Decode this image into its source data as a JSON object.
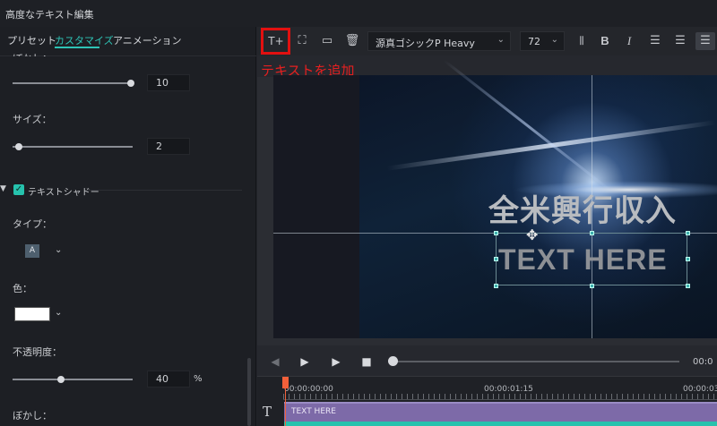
{
  "window": {
    "title": "高度なテキスト編集"
  },
  "tabs": [
    {
      "label": "プリセット"
    },
    {
      "label": "カスタマイズ"
    },
    {
      "label": "アニメーション"
    }
  ],
  "left": {
    "cut_label": "ぼかし：",
    "blur_slider": {
      "value": "10",
      "fraction": 0.9
    },
    "size": {
      "label": "サイズ：",
      "value": "2",
      "fraction": 0.06
    },
    "shadow_section": {
      "label": "テキストシャドー",
      "checked": true
    },
    "type": {
      "label": "タイプ：",
      "selected": "A"
    },
    "color": {
      "label": "色：",
      "value": "#ffffff"
    },
    "opacity": {
      "label": "不透明度：",
      "value": "40",
      "unit": "%",
      "fraction": 0.4
    },
    "blur2": {
      "label": "ぼかし："
    }
  },
  "toolbar": {
    "font": "源真ゴシックP Heavy",
    "size": "72",
    "bold_label": "B",
    "italic_label": "I"
  },
  "annotation": "テキストを追加",
  "preview": {
    "title_jp": "全米興行収入",
    "text_en": "TEXT HERE"
  },
  "player": {
    "time": "00:0",
    "progress": 0.0
  },
  "timeline": {
    "tc": [
      "00:00:00:00",
      "00:00:01:15",
      "00:00:03"
    ],
    "clip_label": "TEXT HERE",
    "track_icon": "T"
  },
  "colors": {
    "accent": "#2ec4b6",
    "annotation": "#e21010",
    "clip": "#7d6aa8",
    "playhead": "#f2603a"
  }
}
